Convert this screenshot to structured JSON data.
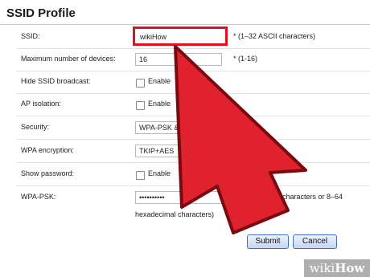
{
  "page": {
    "title": "SSID Profile"
  },
  "fields": {
    "ssid": {
      "label": "SSID:",
      "value": "wikiHow",
      "hint": "*  (1–32 ASCII characters)"
    },
    "max_devices": {
      "label": "Maximum number of devices:",
      "value": "16",
      "hint": "*  (1-16)"
    },
    "hide_ssid": {
      "label": "Hide SSID broadcast:",
      "option": "Enable",
      "checked": false
    },
    "ap_isolation": {
      "label": "AP isolation:",
      "option": "Enable",
      "checked": false
    },
    "security": {
      "label": "Security:",
      "value": "WPA-PSK &"
    },
    "wpa_encryption": {
      "label": "WPA encryption:",
      "value": "TKIP+AES"
    },
    "show_password": {
      "label": "Show password:",
      "option": "Enable",
      "checked": false
    },
    "wpa_psk": {
      "label": "WPA-PSK:",
      "value": "••••••••••",
      "hint": "ASCII characters or 8–64",
      "hint_cont": "hexadecimal characters)"
    }
  },
  "buttons": {
    "submit": "Submit",
    "cancel": "Cancel"
  },
  "watermark": {
    "prefix": "wiki",
    "brand": "How"
  },
  "colors": {
    "arrow": "#e0222e",
    "highlight": "#e0101e",
    "button_border": "#3a70c8"
  }
}
